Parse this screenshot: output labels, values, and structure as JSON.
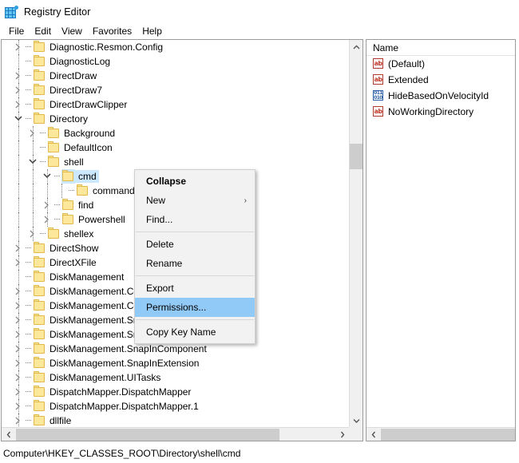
{
  "window": {
    "title": "Registry Editor",
    "icon": "registry-editor-icon"
  },
  "menubar": {
    "items": [
      {
        "label": "File"
      },
      {
        "label": "Edit"
      },
      {
        "label": "View"
      },
      {
        "label": "Favorites"
      },
      {
        "label": "Help"
      }
    ]
  },
  "tree": {
    "rows": [
      {
        "label": "Diagnostic.Resmon.Config",
        "depth": 1,
        "twist": "collapsed"
      },
      {
        "label": "DiagnosticLog",
        "depth": 1,
        "twist": "none"
      },
      {
        "label": "DirectDraw",
        "depth": 1,
        "twist": "collapsed"
      },
      {
        "label": "DirectDraw7",
        "depth": 1,
        "twist": "collapsed"
      },
      {
        "label": "DirectDrawClipper",
        "depth": 1,
        "twist": "collapsed"
      },
      {
        "label": "Directory",
        "depth": 1,
        "twist": "expanded"
      },
      {
        "label": "Background",
        "depth": 2,
        "twist": "collapsed"
      },
      {
        "label": "DefaultIcon",
        "depth": 2,
        "twist": "none"
      },
      {
        "label": "shell",
        "depth": 2,
        "twist": "expanded"
      },
      {
        "label": "cmd",
        "depth": 3,
        "twist": "expanded",
        "selected": true
      },
      {
        "label": "command",
        "depth": 4,
        "twist": "none"
      },
      {
        "label": "find",
        "depth": 3,
        "twist": "collapsed"
      },
      {
        "label": "Powershell",
        "depth": 3,
        "twist": "collapsed"
      },
      {
        "label": "shellex",
        "depth": 2,
        "twist": "collapsed"
      },
      {
        "label": "DirectShow",
        "depth": 1,
        "twist": "collapsed"
      },
      {
        "label": "DirectXFile",
        "depth": 1,
        "twist": "collapsed"
      },
      {
        "label": "DiskManagement",
        "depth": 1,
        "twist": "none"
      },
      {
        "label": "DiskManagement.Connect",
        "depth": 1,
        "twist": "collapsed"
      },
      {
        "label": "DiskManagement.Control",
        "depth": 1,
        "twist": "collapsed"
      },
      {
        "label": "DiskManagement.SnapIn",
        "depth": 1,
        "twist": "collapsed"
      },
      {
        "label": "DiskManagement.SnapInAbout",
        "depth": 1,
        "twist": "collapsed"
      },
      {
        "label": "DiskManagement.SnapInComponent",
        "depth": 1,
        "twist": "collapsed"
      },
      {
        "label": "DiskManagement.SnapInExtension",
        "depth": 1,
        "twist": "collapsed"
      },
      {
        "label": "DiskManagement.UITasks",
        "depth": 1,
        "twist": "collapsed"
      },
      {
        "label": "DispatchMapper.DispatchMapper",
        "depth": 1,
        "twist": "collapsed"
      },
      {
        "label": "DispatchMapper.DispatchMapper.1",
        "depth": 1,
        "twist": "collapsed"
      },
      {
        "label": "dllfile",
        "depth": 1,
        "twist": "collapsed"
      }
    ]
  },
  "values": {
    "column_header": "Name",
    "rows": [
      {
        "name": "(Default)",
        "icon": "string-value-icon"
      },
      {
        "name": "Extended",
        "icon": "string-value-icon"
      },
      {
        "name": "HideBasedOnVelocityId",
        "icon": "binary-value-icon"
      },
      {
        "name": "NoWorkingDirectory",
        "icon": "string-value-icon"
      }
    ],
    "string_icon_text": "ab",
    "binary_icon_text": "011\n010"
  },
  "context_menu": {
    "items": [
      {
        "label": "Collapse",
        "bold": true,
        "type": "item"
      },
      {
        "label": "New",
        "type": "submenu",
        "arrow": "›"
      },
      {
        "label": "Find...",
        "type": "item"
      },
      {
        "type": "separator"
      },
      {
        "label": "Delete",
        "type": "item"
      },
      {
        "label": "Rename",
        "type": "item"
      },
      {
        "type": "separator"
      },
      {
        "label": "Export",
        "type": "item"
      },
      {
        "label": "Permissions...",
        "type": "item",
        "highlighted": true
      },
      {
        "type": "separator"
      },
      {
        "label": "Copy Key Name",
        "type": "item"
      }
    ]
  },
  "statusbar": {
    "path": "Computer\\HKEY_CLASSES_ROOT\\Directory\\shell\\cmd"
  },
  "colors": {
    "selection": "#cce8ff",
    "menu_highlight": "#91c9f7",
    "folder_fill": "#fde79a",
    "folder_border": "#e0b94a",
    "scrollbar_thumb": "#cdcdcd",
    "menu_bg": "#f2f2f2"
  }
}
